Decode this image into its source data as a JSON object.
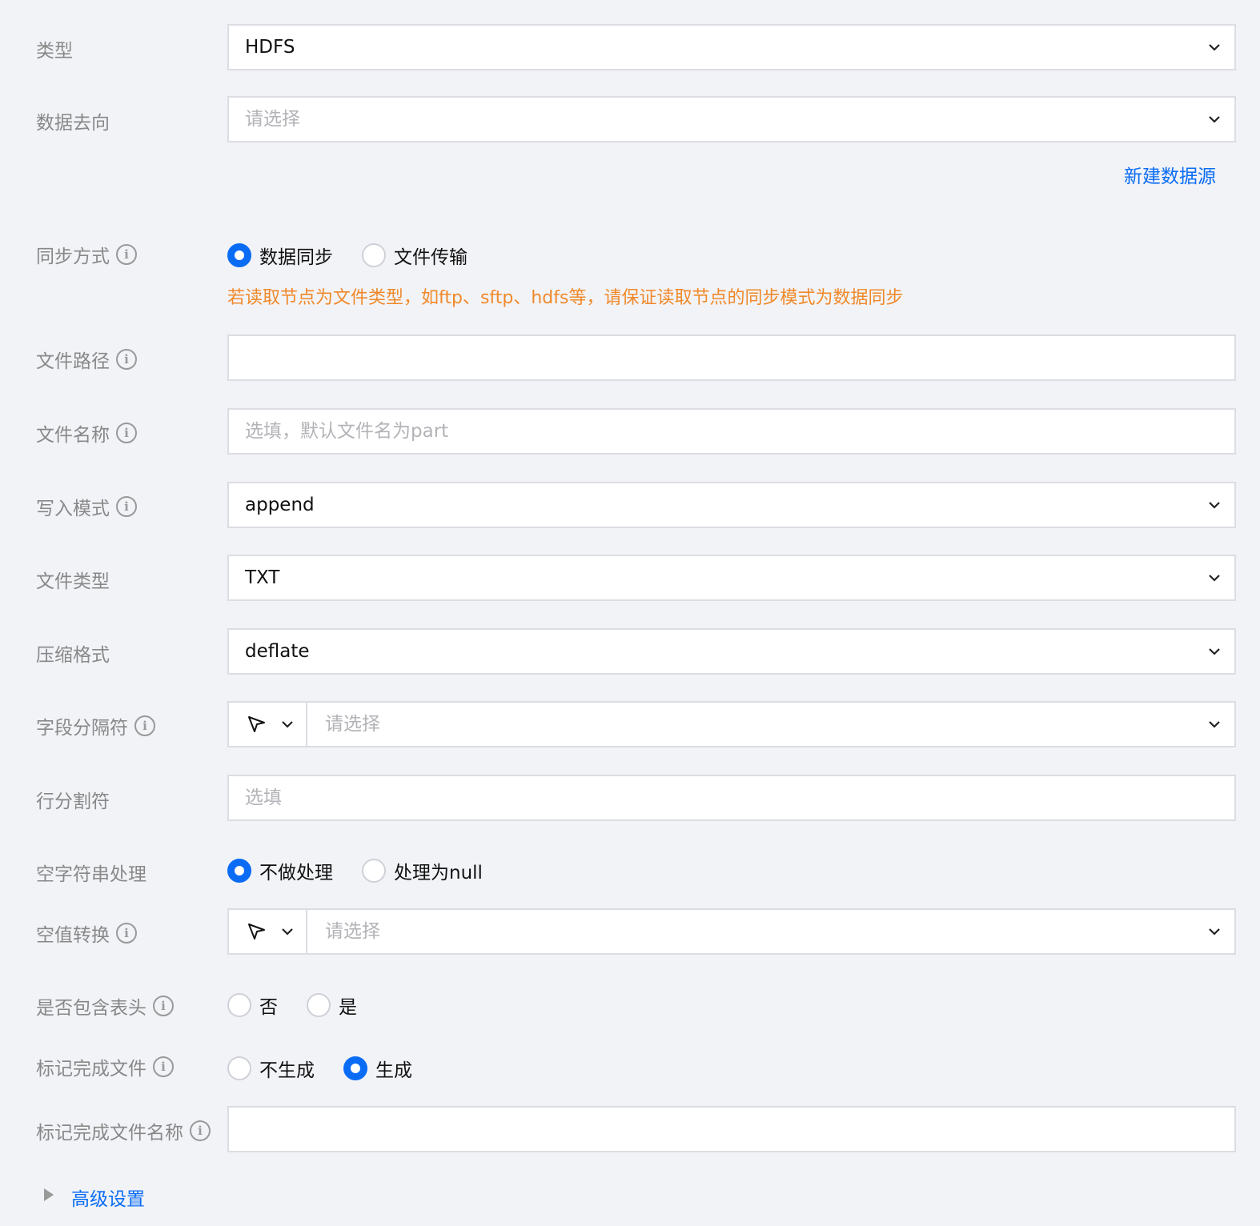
{
  "fields": {
    "type": {
      "label": "类型",
      "value": "HDFS"
    },
    "target": {
      "label": "数据去向",
      "placeholder": "请选择",
      "link": "新建数据源"
    },
    "sync_mode": {
      "label": "同步方式",
      "options": [
        "数据同步",
        "文件传输"
      ],
      "selected": "数据同步",
      "hint": "若读取节点为文件类型，如ftp、sftp、hdfs等，请保证读取节点的同步模式为数据同步"
    },
    "file_path": {
      "label": "文件路径",
      "value": ""
    },
    "file_name": {
      "label": "文件名称",
      "placeholder": "选填，默认文件名为part"
    },
    "write_mode": {
      "label": "写入模式",
      "value": "append"
    },
    "file_type": {
      "label": "文件类型",
      "value": "TXT"
    },
    "compression": {
      "label": "压缩格式",
      "value": "deflate"
    },
    "field_delimiter": {
      "label": "字段分隔符",
      "placeholder": "请选择"
    },
    "line_delimiter": {
      "label": "行分割符",
      "placeholder": "选填"
    },
    "empty_string": {
      "label": "空字符串处理",
      "options": [
        "不做处理",
        "处理为null"
      ],
      "selected": "不做处理"
    },
    "null_conversion": {
      "label": "空值转换",
      "placeholder": "请选择"
    },
    "include_header": {
      "label": "是否包含表头",
      "options": [
        "否",
        "是"
      ],
      "selected": ""
    },
    "mark_done_file": {
      "label": "标记完成文件",
      "options": [
        "不生成",
        "生成"
      ],
      "selected": "生成"
    },
    "mark_done_file_name": {
      "label": "标记完成文件名称",
      "value": ""
    }
  },
  "advanced": {
    "label": "高级设置"
  },
  "icons": {
    "info": "info-icon",
    "chevron": "chevron-down-icon",
    "pointer": "cursor-arrow-icon",
    "expand": "triangle-right-icon"
  },
  "colors": {
    "accent": "#0a6cf5",
    "warning": "#f0892a",
    "background": "#f2f3f7"
  }
}
